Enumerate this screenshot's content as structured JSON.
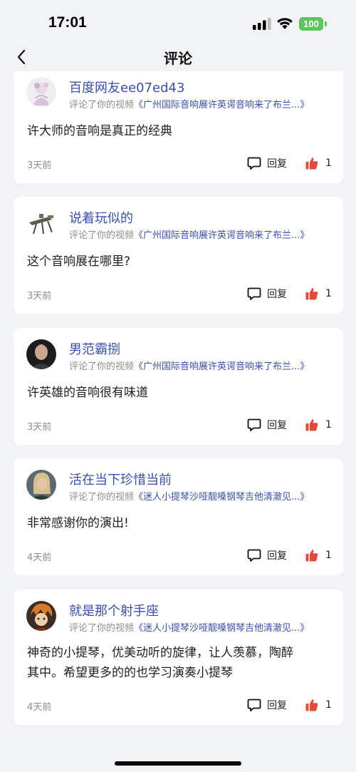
{
  "status_bar": {
    "time": "17:01",
    "battery": "100"
  },
  "nav": {
    "title": "评论"
  },
  "labels": {
    "reply": "回复"
  },
  "comments": [
    {
      "username": "百度网友ee07ed43",
      "action": "评论了你的视频",
      "video_title": "《广州国际音响展许英谔音响来了布兰...》",
      "text": "许大师的音响是真正的经典",
      "time_ago": "3天前",
      "likes": "1"
    },
    {
      "username": "说着玩似的",
      "action": "评论了你的视频",
      "video_title": "《广州国际音响展许英谔音响来了布兰...》",
      "text": "这个音响展在哪里?",
      "time_ago": "3天前",
      "likes": "1"
    },
    {
      "username": "男范霸捌",
      "action": "评论了你的视频",
      "video_title": "《广州国际音响展许英谔音响来了布兰...》",
      "text": "许英雄的音响很有味道",
      "time_ago": "3天前",
      "likes": "1"
    },
    {
      "username": "活在当下珍惜当前",
      "action": "评论了你的视频",
      "video_title": "《迷人小提琴沙哑靓嗓钢琴吉他清澈见...》",
      "text": "非常感谢你的演出!",
      "time_ago": "4天前",
      "likes": "1"
    },
    {
      "username": "就是那个射手座",
      "action": "评论了你的视频",
      "video_title": "《迷人小提琴沙哑靓嗓钢琴吉他清澈见...》",
      "text_line1": "神奇的小提琴，优美动听的旋律，让人羡慕，陶醉",
      "text_line2": "其中。希望更多的的也学习演奏小提琴",
      "time_ago": "4天前",
      "likes": "1"
    }
  ]
}
